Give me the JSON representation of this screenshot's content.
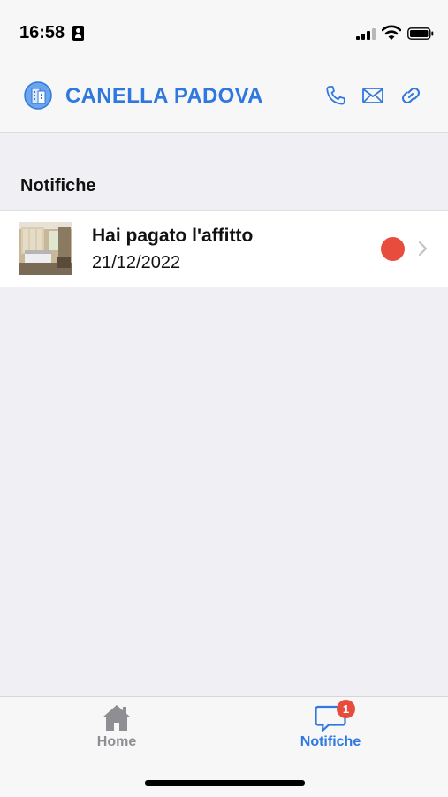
{
  "status_bar": {
    "time": "16:58"
  },
  "header": {
    "title": "CANELLA PADOVA",
    "logo_icon": "building-logo-icon",
    "actions": [
      "phone-icon",
      "mail-icon",
      "link-icon"
    ],
    "accent_color": "#2f78df"
  },
  "section": {
    "title": "Notifiche"
  },
  "notifications": [
    {
      "title": "Hai pagato l'affitto",
      "date": "21/12/2022",
      "unread": true,
      "unread_color": "#e84c3d"
    }
  ],
  "tabbar": {
    "tabs": [
      {
        "label": "Home",
        "icon": "home-icon",
        "active": false
      },
      {
        "label": "Notifiche",
        "icon": "chat-bubble-icon",
        "active": true,
        "badge": "1"
      }
    ]
  }
}
